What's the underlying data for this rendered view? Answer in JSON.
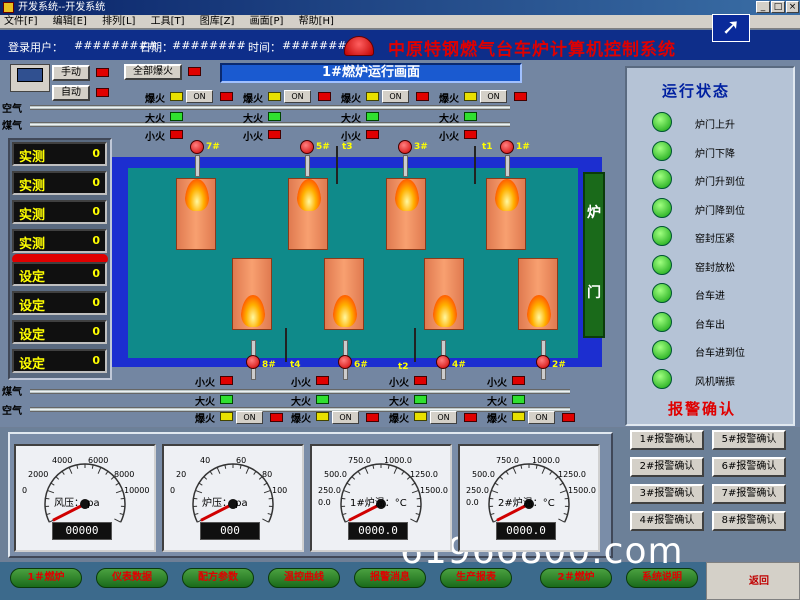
{
  "window": {
    "title": "开发系统--开发系统"
  },
  "menu": [
    "文件[F]",
    "编辑[E]",
    "排列[L]",
    "工具[T]",
    "图库[Z]",
    "画面[P]",
    "帮助[H]"
  ],
  "info": {
    "user_label": "登录用户：",
    "user_value": "#########",
    "date_label": "日期：",
    "date_value": "########",
    "time_label": "时间：",
    "time_value": "########",
    "system_title": "中原特钢燃气台车炉计算机控制系统"
  },
  "controls": {
    "manual": "手动",
    "auto": "自动",
    "all_ignite": "全部爆火",
    "screen_title": "1#燃炉运行画面"
  },
  "labels": {
    "air": "空气",
    "gas": "煤气",
    "ignite": "爆火",
    "big_fire": "大火",
    "small_fire": "小火",
    "on": "ON",
    "door_top": "炉",
    "door_bottom": "门"
  },
  "burners_top": [
    "7#",
    "5#",
    "3#",
    "1#"
  ],
  "burners_bottom": [
    "8#",
    "6#",
    "4#",
    "2#"
  ],
  "thermocouples_top": [
    "t3",
    "t1"
  ],
  "thermocouples_bottom": [
    "t4",
    "t2"
  ],
  "measure_rows": [
    {
      "label": "实测",
      "value": "0"
    },
    {
      "label": "实测",
      "value": "0"
    },
    {
      "label": "实测",
      "value": "0"
    },
    {
      "label": "实测",
      "value": "0"
    },
    {
      "label": "设定",
      "value": "0"
    },
    {
      "label": "设定",
      "value": "0"
    },
    {
      "label": "设定",
      "value": "0"
    },
    {
      "label": "设定",
      "value": "0"
    }
  ],
  "status": {
    "title": "运行状态",
    "items": [
      "炉门上升",
      "炉门下降",
      "炉门升到位",
      "炉门降到位",
      "窑封压紧",
      "窑封放松",
      "台车进",
      "台车出",
      "台车进到位",
      "风机喘振"
    ]
  },
  "alarm": {
    "title": "报警确认",
    "buttons": [
      "1#报警确认",
      "5#报警确认",
      "2#报警确认",
      "6#报警确认",
      "3#报警确认",
      "7#报警确认",
      "4#报警确认",
      "8#报警确认"
    ]
  },
  "gauges": [
    {
      "label": "风压：  pa",
      "ticks": [
        "2000",
        "4000",
        "6000",
        "8000"
      ],
      "end_ticks": [
        "0",
        "10000"
      ],
      "readout": "00000",
      "needle_fraction": 0.0
    },
    {
      "label": "炉压：  pa",
      "ticks": [
        "20",
        "40",
        "60",
        "80"
      ],
      "end_ticks": [
        "0",
        "100"
      ],
      "readout": "000",
      "needle_fraction": 0.0
    },
    {
      "label": "1#炉温：°C",
      "ticks": [
        "500.0",
        "750.0",
        "1000.0",
        "1250.0"
      ],
      "end_ticks": [
        "250.0",
        "1500.0",
        "0.0"
      ],
      "readout": "0000.0",
      "needle_fraction": 0.0
    },
    {
      "label": "2#炉温：°C",
      "ticks": [
        "500.0",
        "750.0",
        "1000.0",
        "1250.0"
      ],
      "end_ticks": [
        "250.0",
        "1500.0",
        "0.0"
      ],
      "readout": "0000.0",
      "needle_fraction": 0.0
    }
  ],
  "nav": [
    "1＃燃炉",
    "仪表数据",
    "配方参数",
    "温控曲线",
    "报警消息",
    "生产报表",
    "2＃燃炉",
    "系统说明"
  ],
  "watermark": "61966800.com",
  "corner_text": "返回"
}
